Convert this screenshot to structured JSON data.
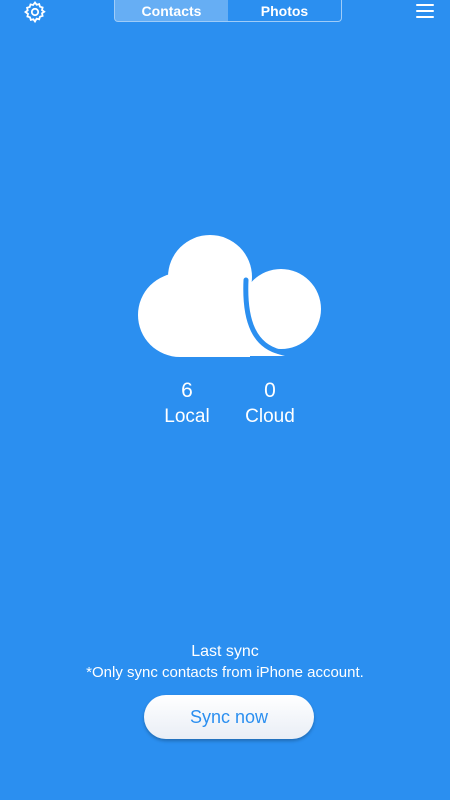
{
  "top_bar": {
    "tabs": [
      {
        "label": "Contacts",
        "active": true
      },
      {
        "label": "Photos",
        "active": false
      }
    ],
    "left_icon": "gear-icon",
    "right_icon": "hamburger-menu-icon"
  },
  "hero": {
    "icon": "cloud-icon"
  },
  "counts": {
    "local": {
      "value": "6",
      "label": "Local"
    },
    "cloud": {
      "value": "0",
      "label": "Cloud"
    }
  },
  "footer": {
    "last_sync_label": "Last sync",
    "note": "*Only sync contacts from iPhone account.",
    "sync_button_label": "Sync now"
  },
  "colors": {
    "background": "#2b8ff0",
    "text": "#ffffff",
    "button_text": "#2b8ff0"
  }
}
